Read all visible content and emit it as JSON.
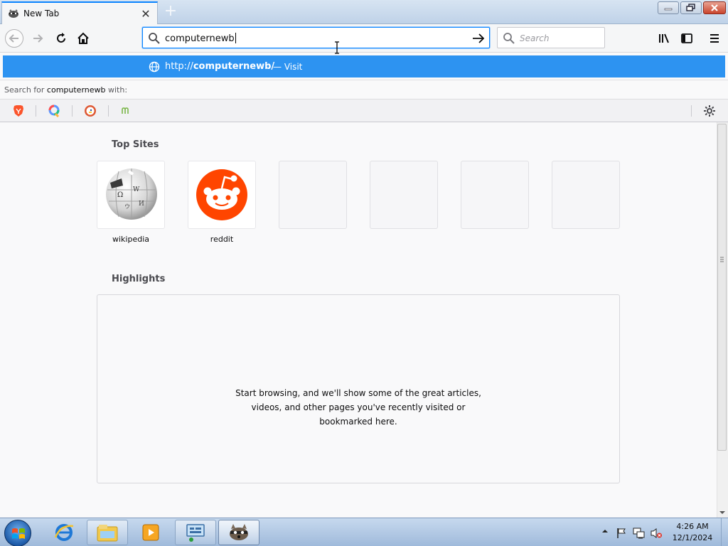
{
  "browser": {
    "tab": {
      "title": "New Tab",
      "close_glyph": "✕"
    },
    "newtab_glyph": "+",
    "urlbar": {
      "value": "computernewb"
    },
    "searchbar": {
      "placeholder": "Search"
    }
  },
  "autocomplete": {
    "url_prefix": "http://",
    "url_bold": "computernewb/",
    "visit_label": "— Visit",
    "search_prefix": "Search for ",
    "search_query": "computernewb",
    "search_suffix": " with:",
    "engines": [
      "brave-icon",
      "qwant-icon",
      "duckduckgo-icon",
      "mojeek-icon"
    ]
  },
  "newtab": {
    "top_sites_title": "Top Sites",
    "top_sites": [
      {
        "label": "wikipedia",
        "icon": "wikipedia-icon"
      },
      {
        "label": "reddit",
        "icon": "reddit-icon"
      },
      {
        "label": ""
      },
      {
        "label": ""
      },
      {
        "label": ""
      },
      {
        "label": ""
      }
    ],
    "highlights_title": "Highlights",
    "highlights_message": [
      "Start browsing, and we'll show some of the great articles,",
      "videos, and other pages you've recently visited or",
      "bookmarked here."
    ]
  },
  "taskbar": {
    "clock_time": "4:26 AM",
    "clock_date": "12/1/2024",
    "items": [
      "internet-explorer-icon",
      "file-explorer-icon",
      "media-player-icon",
      "network-icon",
      "firefox-icon"
    ]
  },
  "colors": {
    "accent": "#0a84ff",
    "autocomplete_bg": "#2d93f1",
    "reddit": "#ff4500"
  }
}
